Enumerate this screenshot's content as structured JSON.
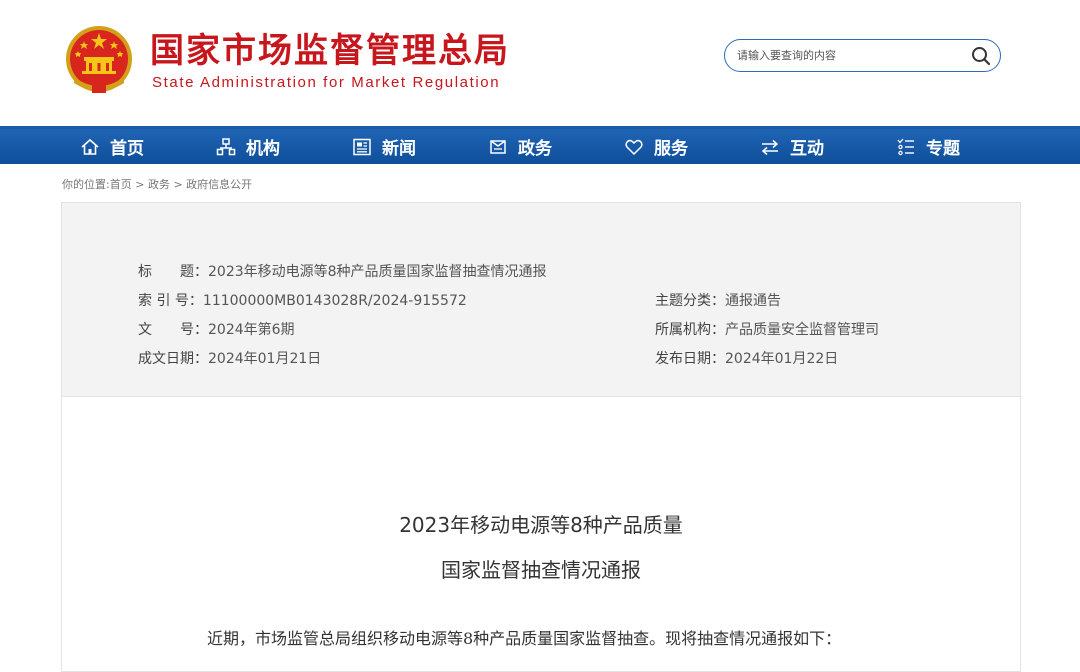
{
  "header": {
    "title": "国家市场监督管理总局",
    "subtitle": "State Administration for Market Regulation",
    "logo_icon": "national-emblem-icon",
    "brand_color": "#c8161d"
  },
  "search": {
    "placeholder": "请输入要查询的内容",
    "icon": "search-icon"
  },
  "nav": {
    "background": "#1a5aa8",
    "items": [
      {
        "label": "首页",
        "icon": "home-icon"
      },
      {
        "label": "机构",
        "icon": "org-chart-icon"
      },
      {
        "label": "新闻",
        "icon": "news-icon"
      },
      {
        "label": "政务",
        "icon": "government-affairs-icon"
      },
      {
        "label": "服务",
        "icon": "heart-icon"
      },
      {
        "label": "互动",
        "icon": "exchange-arrows-icon"
      },
      {
        "label": "专题",
        "icon": "topic-list-icon"
      }
    ]
  },
  "breadcrumb": {
    "prefix": "你的位置:",
    "items": [
      "首页",
      "政务",
      "政府信息公开"
    ],
    "separator": ">"
  },
  "meta": {
    "title_label": "标　　题：",
    "title_value": "2023年移动电源等8种产品质量国家监督抽查情况通报",
    "index_label": "索 引 号：",
    "index_value": "11100000MB0143028R/2024-915572",
    "topic_label": "主题分类：",
    "topic_value": "通报通告",
    "docno_label": "文　　号：",
    "docno_value": "2024年第6期",
    "org_label": "所属机构：",
    "org_value": "产品质量安全监督管理司",
    "created_label": "成文日期：",
    "created_value": "2024年01月21日",
    "published_label": "发布日期：",
    "published_value": "2024年01月22日"
  },
  "article": {
    "title_line1": "2023年移动电源等8种产品质量",
    "title_line2": "国家监督抽查情况通报",
    "paragraph1": "近期，市场监管总局组织移动电源等8种产品质量国家监督抽查。现将抽查情况通报如下："
  }
}
